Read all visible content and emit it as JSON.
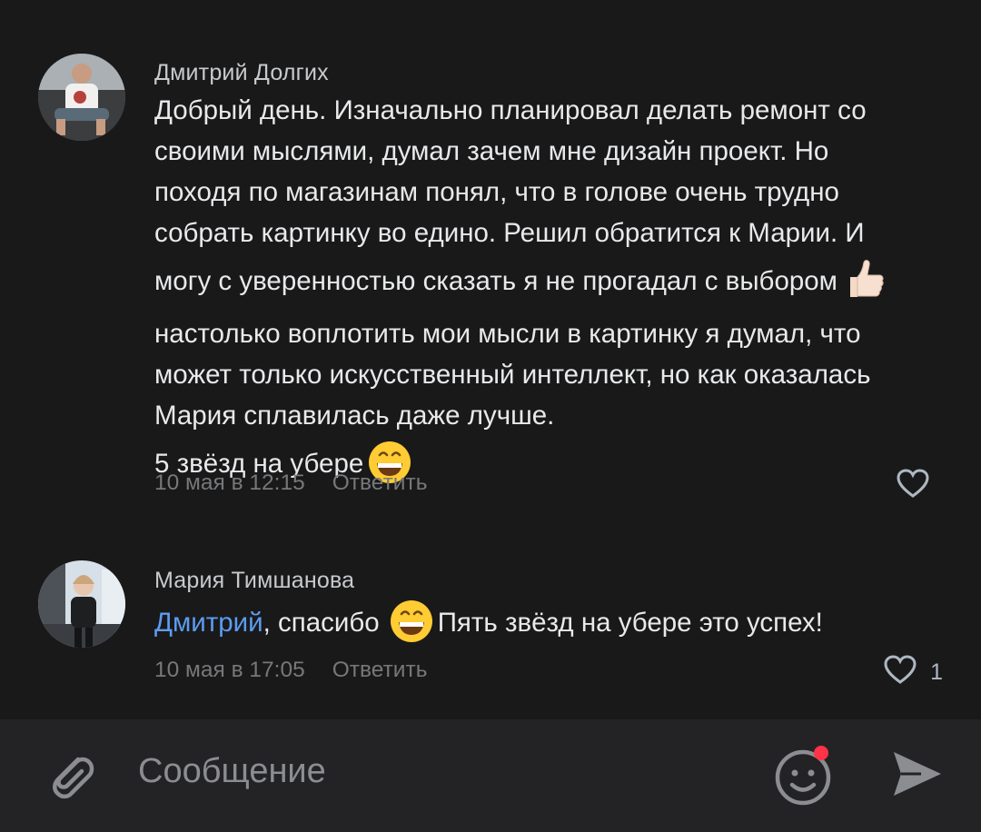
{
  "comments": [
    {
      "author": "Дмитрий Долгих",
      "lines": [
        "Добрый день. Изначально планировал делать ремонт со",
        "своими мыслями, думал зачем мне дизайн проект. Но",
        "походя по магазинам понял, что в голове очень трудно",
        "собрать картинку во едино. Решил обратится к Марии. И",
        "могу с уверенностью сказать я не прогадал с выбором",
        "настолько воплотить мои мысли в картинку я думал, что",
        "может только искусственный интеллект, но как оказалась",
        "Мария сплавилась даже лучше.",
        "5 звёзд на убере"
      ],
      "emojis": {
        "line_5": "thumbs-up-icon",
        "line_9": "grinning-face-icon"
      },
      "timestamp": "10 мая в 12:15",
      "reply_label": "Ответить",
      "likes": ""
    },
    {
      "author": "Мария Тимшанова",
      "mention": "Дмитрий",
      "text_part1": ", спасибо",
      "text_part2": "Пять звёзд на убере это успех!",
      "emoji": "grinning-face-icon",
      "timestamp": "10 мая в 17:05",
      "reply_label": "Ответить",
      "likes": "1"
    }
  ],
  "composer": {
    "placeholder": "Сообщение",
    "has_notification_dot": true
  },
  "colors": {
    "background": "#19191a",
    "composer": "#232325",
    "mention": "#5c9cf0",
    "notification": "#ff3347"
  }
}
